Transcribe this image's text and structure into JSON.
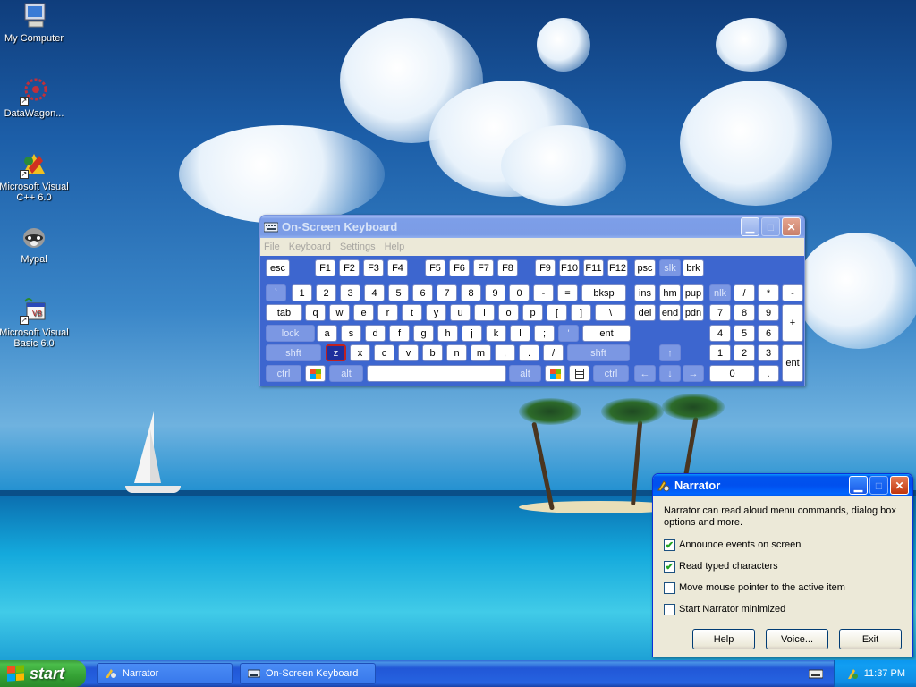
{
  "desktop": {
    "icons": [
      {
        "label": "My Computer"
      },
      {
        "label": "DataWagon..."
      },
      {
        "label": "Microsoft Visual C++ 6.0"
      },
      {
        "label": "Mypal"
      },
      {
        "label": "Microsoft Visual Basic 6.0"
      }
    ]
  },
  "osk": {
    "title": "On-Screen Keyboard",
    "menu": [
      "File",
      "Keyboard",
      "Settings",
      "Help"
    ],
    "rows": {
      "fn": [
        "esc",
        "F1",
        "F2",
        "F3",
        "F4",
        "F5",
        "F6",
        "F7",
        "F8",
        "F9",
        "F10",
        "F11",
        "F12",
        "psc",
        "slk",
        "brk"
      ],
      "num": [
        "`",
        "1",
        "2",
        "3",
        "4",
        "5",
        "6",
        "7",
        "8",
        "9",
        "0",
        "-",
        "=",
        "bksp",
        "ins",
        "hm",
        "pup",
        "nlk",
        "/",
        "*",
        "-"
      ],
      "top": [
        "tab",
        "q",
        "w",
        "e",
        "r",
        "t",
        "y",
        "u",
        "i",
        "o",
        "p",
        "[",
        "]",
        "\\",
        "del",
        "end",
        "pdn",
        "7",
        "8",
        "9",
        "+"
      ],
      "home": [
        "lock",
        "a",
        "s",
        "d",
        "f",
        "g",
        "h",
        "j",
        "k",
        "l",
        ";",
        "'",
        "ent",
        "4",
        "5",
        "6"
      ],
      "bottom": [
        "shft",
        "z",
        "x",
        "c",
        "v",
        "b",
        "n",
        "m",
        ",",
        ".",
        "/",
        "shft",
        "↑",
        "1",
        "2",
        "3",
        "ent"
      ],
      "space": [
        "ctrl",
        "alt",
        "alt",
        "ctrl",
        "←",
        "↓",
        "→",
        "0",
        "."
      ]
    }
  },
  "narrator": {
    "title": "Narrator",
    "description": "Narrator can read aloud menu commands, dialog box options and more.",
    "options": [
      {
        "label": "Announce events on screen",
        "checked": true
      },
      {
        "label": "Read typed characters",
        "checked": true
      },
      {
        "label": "Move mouse pointer to the active item",
        "checked": false
      },
      {
        "label": "Start Narrator minimized",
        "checked": false
      }
    ],
    "buttons": {
      "help": "Help",
      "voice": "Voice...",
      "exit": "Exit"
    }
  },
  "taskbar": {
    "start": "start",
    "tasks": [
      "Narrator",
      "On-Screen Keyboard"
    ],
    "clock": "11:37 PM"
  }
}
